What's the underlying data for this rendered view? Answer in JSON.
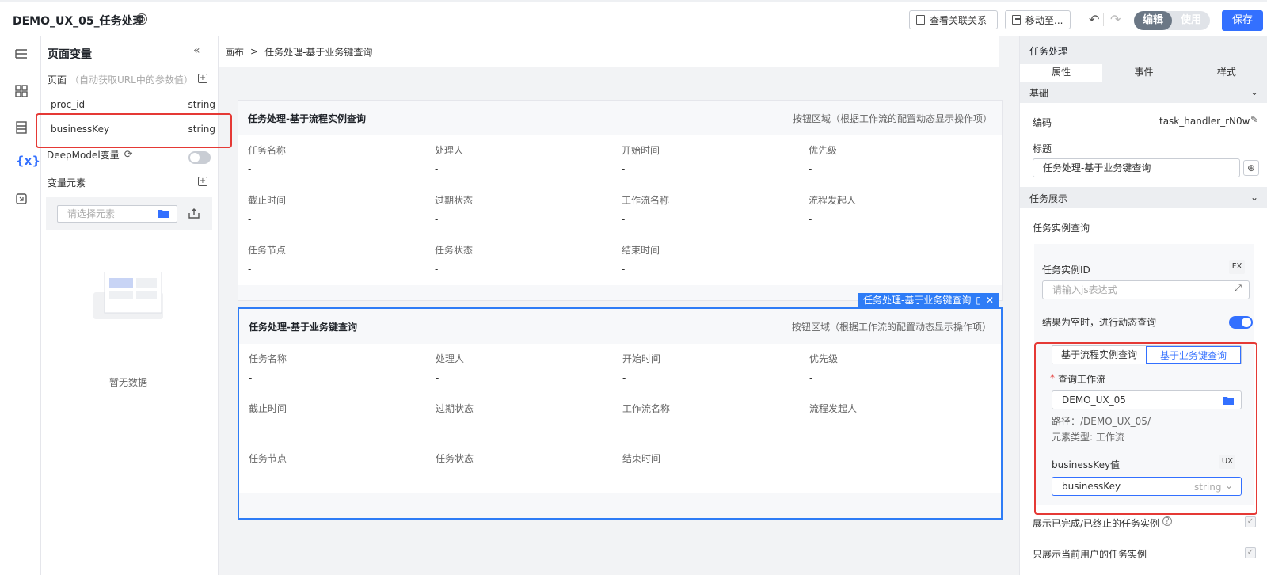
{
  "header": {
    "title": "DEMO_UX_05_任务处理",
    "view_relations": "查看关联关系",
    "move_to": "移动至...",
    "mode_edit": "编辑",
    "mode_use": "使用",
    "save": "保存"
  },
  "left_rail": {
    "variables_icon_text": "{x}"
  },
  "left_panel": {
    "title": "页面变量",
    "page_label": "页面",
    "page_hint": "（自动获取URL中的参数值）",
    "variables": [
      {
        "name": "proc_id",
        "type": "string"
      },
      {
        "name": "businessKey",
        "type": "string"
      }
    ],
    "deepmodel_label": "DeepModel变量",
    "elements_label": "变量元素",
    "element_placeholder": "请选择元素",
    "empty_text": "暂无数据"
  },
  "breadcrumb": {
    "root": "画布",
    "sep": ">",
    "current": "任务处理-基于业务键查询"
  },
  "cards": [
    {
      "title": "任务处理-基于流程实例查询",
      "note": "按钮区域（根据工作流的配置动态显示操作项）",
      "fields": [
        {
          "label": "任务名称",
          "value": "-"
        },
        {
          "label": "处理人",
          "value": "-"
        },
        {
          "label": "开始时间",
          "value": "-"
        },
        {
          "label": "优先级",
          "value": "-"
        },
        {
          "label": "截止时间",
          "value": "-"
        },
        {
          "label": "过期状态",
          "value": "-"
        },
        {
          "label": "工作流名称",
          "value": "-"
        },
        {
          "label": "流程发起人",
          "value": "-"
        },
        {
          "label": "任务节点",
          "value": "-"
        },
        {
          "label": "任务状态",
          "value": "-"
        },
        {
          "label": "结束时间",
          "value": "-"
        }
      ]
    },
    {
      "title": "任务处理-基于业务键查询",
      "note": "按钮区域（根据工作流的配置动态显示操作项）",
      "fields": [
        {
          "label": "任务名称",
          "value": "-"
        },
        {
          "label": "处理人",
          "value": "-"
        },
        {
          "label": "开始时间",
          "value": "-"
        },
        {
          "label": "优先级",
          "value": "-"
        },
        {
          "label": "截止时间",
          "value": "-"
        },
        {
          "label": "过期状态",
          "value": "-"
        },
        {
          "label": "工作流名称",
          "value": "-"
        },
        {
          "label": "流程发起人",
          "value": "-"
        },
        {
          "label": "任务节点",
          "value": "-"
        },
        {
          "label": "任务状态",
          "value": "-"
        },
        {
          "label": "结束时间",
          "value": "-"
        }
      ]
    }
  ],
  "selection_tag": "任务处理-基于业务键查询",
  "right_panel": {
    "header": "任务处理",
    "tabs": [
      "属性",
      "事件",
      "样式"
    ],
    "basic_section": "基础",
    "code_label": "编码",
    "code_value": "task_handler_rN0w",
    "title_label": "标题",
    "title_value": "任务处理-基于业务键查询",
    "display_section": "任务展示",
    "query_label": "任务实例查询",
    "instance_id_label": "任务实例ID",
    "fx_badge": "FX",
    "instance_id_placeholder": "请输入js表达式",
    "dynamic_query_label": "结果为空时，进行动态查询",
    "seg_a": "基于流程实例查询",
    "seg_b": "基于业务键查询",
    "workflow_label": "查询工作流",
    "workflow_value": "DEMO_UX_05",
    "path_text": "路径：/DEMO_UX_05/",
    "element_type_text": "元素类型: 工作流",
    "bk_label": "businessKey值",
    "ux_badge": "UX",
    "bk_value": "businessKey",
    "bk_type": "string",
    "show_finished_label": "展示已完成/已终止的任务实例",
    "only_current_label": "只展示当前用户的任务实例"
  }
}
